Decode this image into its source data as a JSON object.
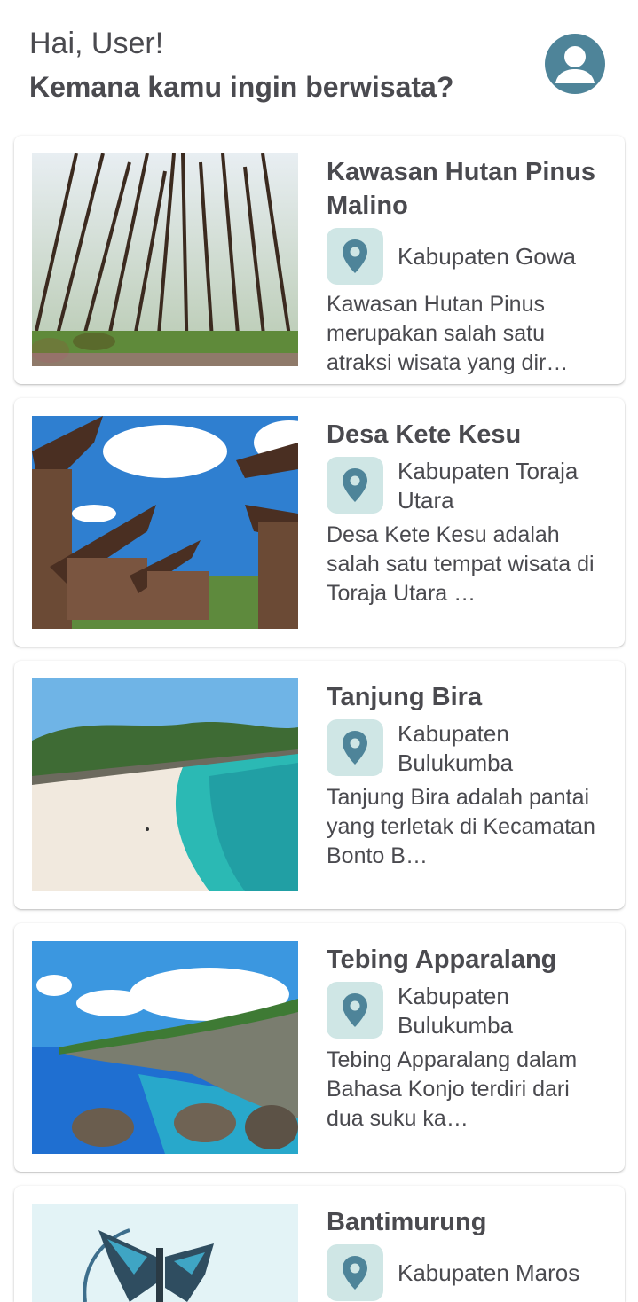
{
  "header": {
    "greeting": "Hai, User!",
    "question": "Kemana kamu ingin berwisata?",
    "avatar_icon": "user-avatar-icon"
  },
  "colors": {
    "accent": "#4e8499",
    "pin_background": "#cfe6e5",
    "text": "#4a4a4f"
  },
  "places": [
    {
      "title": "Kawasan Hutan Pinus Malino",
      "location": "Kabupaten Gowa",
      "description": "Kawasan Hutan Pinus merupakan salah satu atraksi wisata yang dir…",
      "image": "pine-forest-photo"
    },
    {
      "title": "Desa Kete Kesu",
      "location": "Kabupaten Toraja Utara",
      "description": "Desa Kete Kesu adalah salah satu tempat wisata di Toraja Utara …",
      "image": "tongkonan-houses-photo"
    },
    {
      "title": "Tanjung Bira",
      "location": "Kabupaten Bulukumba",
      "description": "Tanjung Bira adalah pantai yang terletak di Kecamatan Bonto B…",
      "image": "white-sand-beach-photo"
    },
    {
      "title": "Tebing Apparalang",
      "location": "Kabupaten Bulukumba",
      "description": "Tebing Apparalang dalam Bahasa Konjo terdiri dari dua suku ka…",
      "image": "sea-cliff-photo"
    },
    {
      "title": "Bantimurung",
      "location": "Kabupaten Maros",
      "description": "",
      "image": "butterfly-statue-photo"
    }
  ]
}
